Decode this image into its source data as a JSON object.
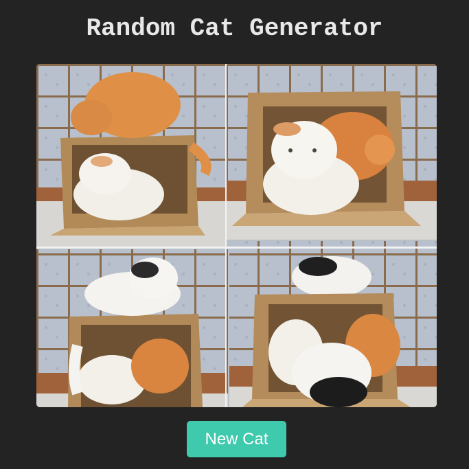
{
  "app": {
    "title": "Random Cat Generator"
  },
  "image": {
    "subject": "collage of four photos of cats with a cardboard box"
  },
  "controls": {
    "new_cat_label": "New Cat"
  },
  "colors": {
    "background": "#232323",
    "title_text": "#e8e8e8",
    "button_background": "#3fc9ad",
    "button_text": "#ffffff"
  }
}
